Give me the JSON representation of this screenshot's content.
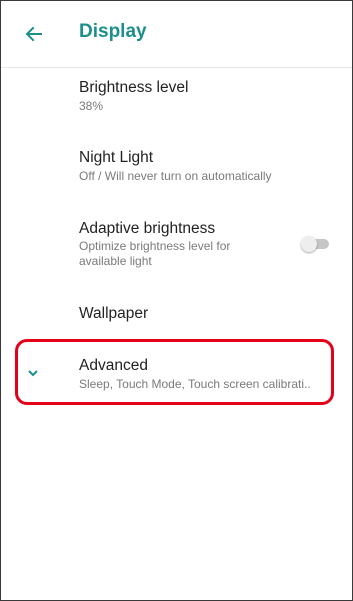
{
  "header": {
    "title": "Display",
    "back_icon": "arrow-back-icon"
  },
  "items": [
    {
      "title": "Brightness level",
      "subtitle": "38%"
    },
    {
      "title": "Night Light",
      "subtitle": "Off / Will never turn on automatically"
    },
    {
      "title": "Adaptive brightness",
      "subtitle_line1": "Optimize brightness level for",
      "subtitle_line2": "available light",
      "toggle": "off"
    },
    {
      "title": "Wallpaper"
    },
    {
      "title": "Advanced",
      "subtitle": "Sleep, Touch Mode, Touch screen calibrati..",
      "icon": "chevron-down-icon",
      "highlighted": true
    }
  ],
  "colors": {
    "accent": "#1c8f8c",
    "highlight": "#e3001b"
  }
}
